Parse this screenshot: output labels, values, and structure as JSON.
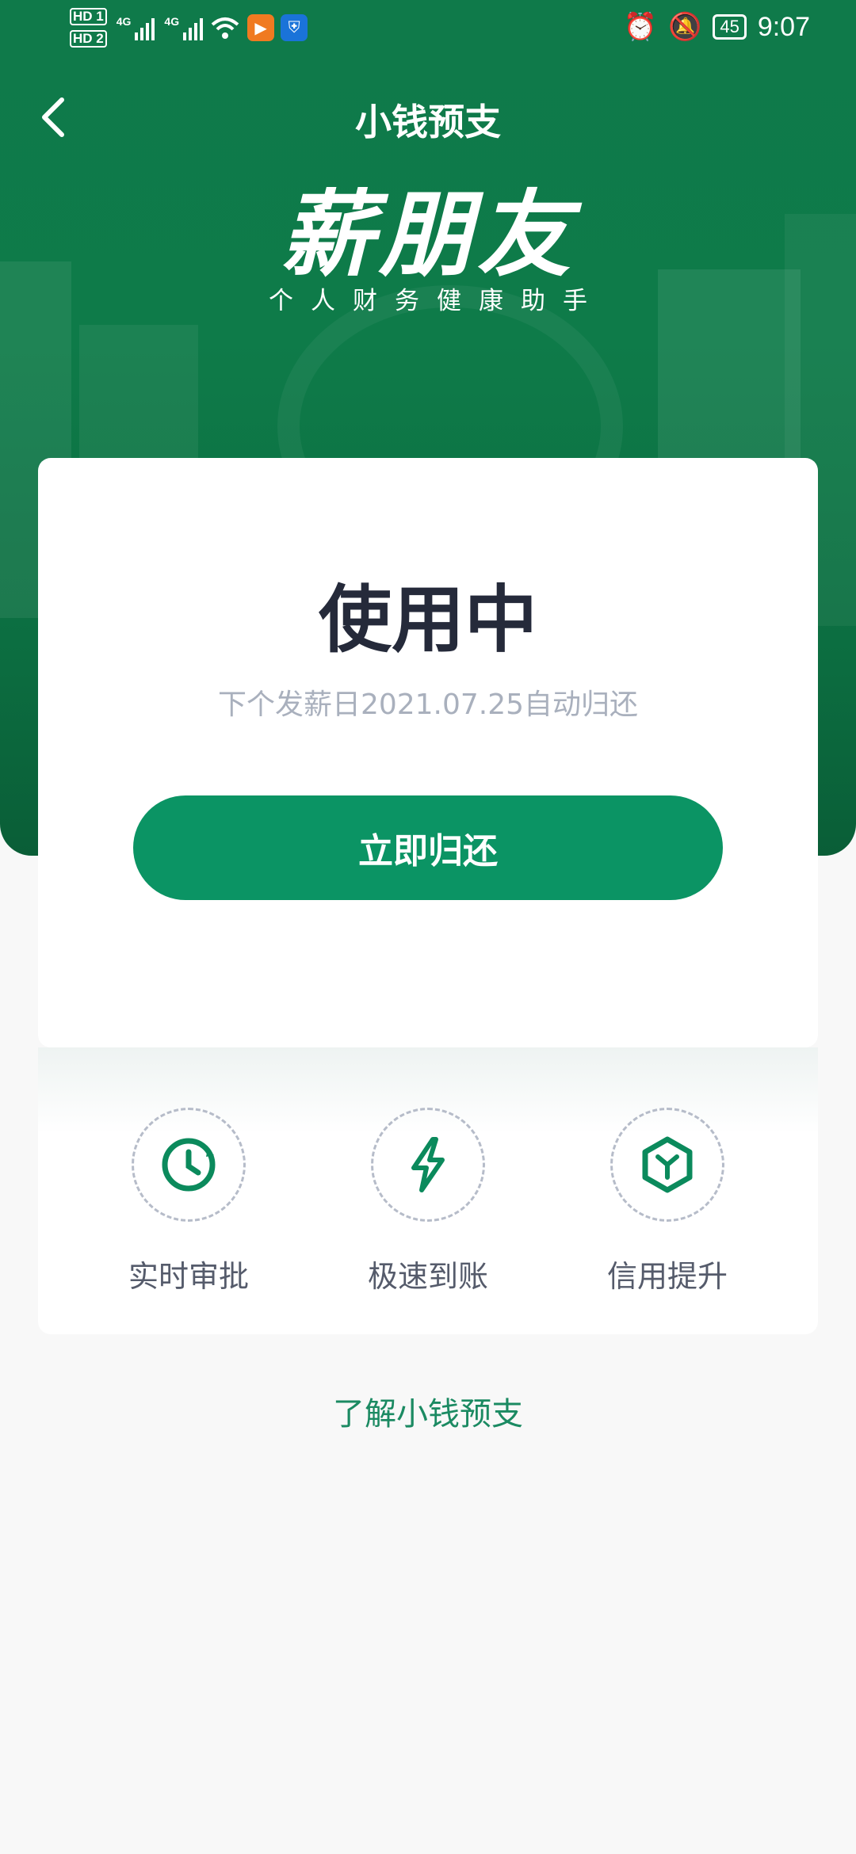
{
  "status_bar": {
    "sim_labels": [
      "HD 1",
      "HD 2"
    ],
    "network_labels": [
      "4G",
      "4G"
    ],
    "battery": "45",
    "time": "9:07"
  },
  "header": {
    "title": "小钱预支",
    "brand": "薪朋友",
    "slogan": "个人财务健康助手"
  },
  "card": {
    "status": "使用中",
    "note": "下个发薪日2021.07.25自动归还",
    "button_label": "立即归还"
  },
  "features": [
    {
      "label": "实时审批",
      "icon": "clock-icon"
    },
    {
      "label": "极速到账",
      "icon": "lightning-icon"
    },
    {
      "label": "信用提升",
      "icon": "cube-icon"
    }
  ],
  "footer": {
    "link_label": "了解小钱预支"
  },
  "colors": {
    "primary": "#0b9464",
    "hero": "#0f7a4a",
    "title_text": "#252a3a",
    "muted": "#a9b0bd"
  }
}
